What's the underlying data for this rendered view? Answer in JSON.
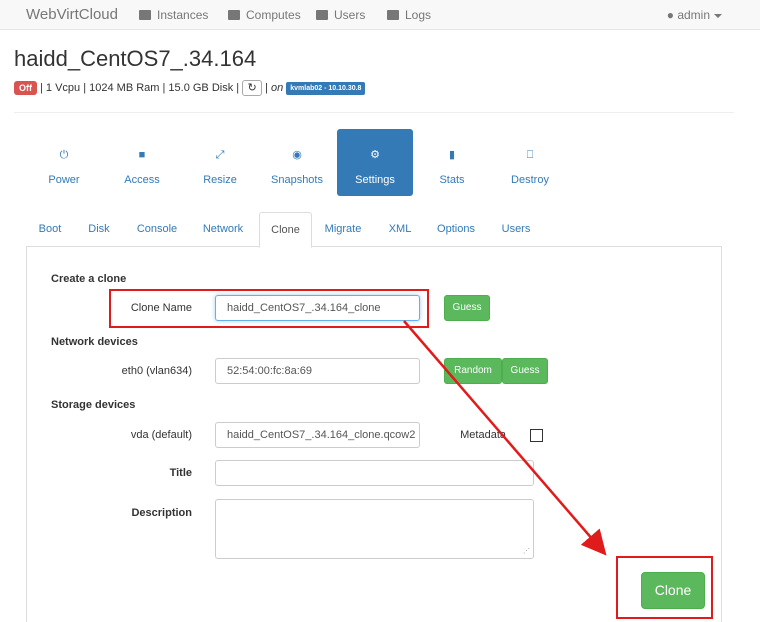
{
  "navbar": {
    "brand": "WebVirtCloud",
    "items": [
      {
        "label": "Instances",
        "icon": "monitor-icon"
      },
      {
        "label": "Computes",
        "icon": "server-icon"
      },
      {
        "label": "Users",
        "icon": "users-icon"
      },
      {
        "label": "Logs",
        "icon": "list-icon"
      }
    ],
    "user": "admin"
  },
  "instance": {
    "name": "haidd_CentOS7_.34.164",
    "status": "Off",
    "specs": "| 1 Vcpu | 1024 MB Ram | 15.0 GB Disk |",
    "on_text": "on",
    "host": "kvmlab02 - 10.10.30.8"
  },
  "actions": [
    {
      "label": "Power",
      "icon": "power-icon",
      "active": false
    },
    {
      "label": "Access",
      "icon": "lock-icon",
      "active": false
    },
    {
      "label": "Resize",
      "icon": "resize-icon",
      "active": false
    },
    {
      "label": "Snapshots",
      "icon": "camera-icon",
      "active": false
    },
    {
      "label": "Settings",
      "icon": "gear-icon",
      "active": true
    },
    {
      "label": "Stats",
      "icon": "stats-icon",
      "active": false
    },
    {
      "label": "Destroy",
      "icon": "trash-icon",
      "active": false
    }
  ],
  "tabs": [
    "Boot",
    "Disk",
    "Console",
    "Network",
    "Clone",
    "Migrate",
    "XML",
    "Options",
    "Users"
  ],
  "active_tab": "Clone",
  "clone": {
    "section_clone": "Create a clone",
    "clone_name_label": "Clone Name",
    "clone_name_value": "haidd_CentOS7_.34.164_clone",
    "guess_label": "Guess",
    "section_network": "Network devices",
    "eth_label": "eth0 (vlan634)",
    "mac_value": "52:54:00:fc:8a:69",
    "random_label": "Random",
    "guess_label_2": "Guess",
    "section_storage": "Storage devices",
    "vda_label": "vda (default)",
    "vda_value": "haidd_CentOS7_.34.164_clone.qcow2",
    "metadata_label": "Metadata",
    "metadata_checked": false,
    "title_label": "Title",
    "title_value": "",
    "description_label": "Description",
    "description_value": "",
    "clone_button": "Clone"
  },
  "annotation_color": "#e01b1b"
}
